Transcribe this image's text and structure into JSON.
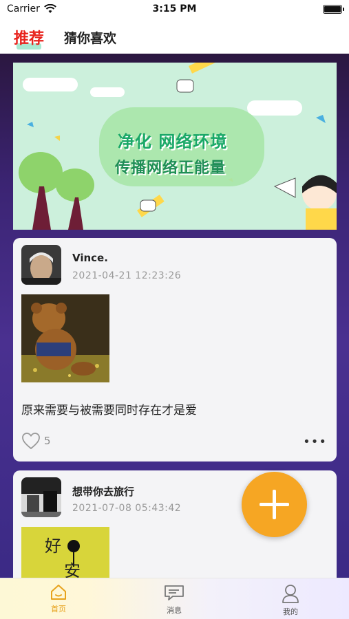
{
  "status_bar": {
    "carrier": "Carrier",
    "time": "3:15 PM"
  },
  "header": {
    "tabs": [
      {
        "label": "推荐",
        "active": true
      },
      {
        "label": "猜你喜欢",
        "active": false
      }
    ]
  },
  "banner": {
    "line1": "净化 网络环境",
    "line2": "传播网络正能量"
  },
  "posts": [
    {
      "username": "Vince.",
      "timestamp": "2021-04-21 12:23:26",
      "text": "原来需要与被需要同时存在才是爱",
      "likes": "5"
    },
    {
      "username": "想带你去旅行",
      "timestamp": "2021-07-08 05:43:42"
    }
  ],
  "tab_bar": {
    "items": [
      {
        "label": "首页",
        "icon": "home-icon",
        "active": true
      },
      {
        "label": "消息",
        "icon": "message-icon",
        "active": false
      },
      {
        "label": "我的",
        "icon": "profile-icon",
        "active": false
      }
    ]
  },
  "colors": {
    "accent_red": "#e8231d",
    "fab_orange": "#f6a623",
    "feed_purple": "#3b2473",
    "active_tab": "#e7a21c"
  }
}
